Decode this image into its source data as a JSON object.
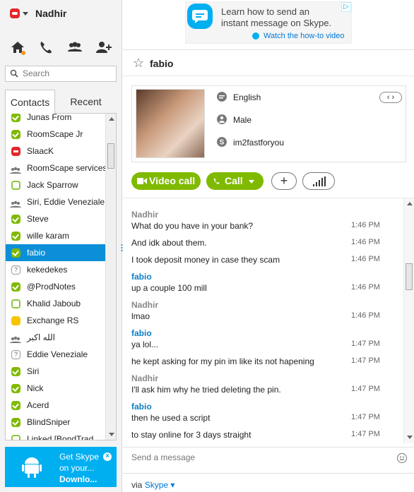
{
  "user": {
    "name": "Nadhir"
  },
  "nav": {
    "icons": [
      "home-icon",
      "phone-icon",
      "contacts-icon",
      "add-contact-icon"
    ]
  },
  "search": {
    "placeholder": "Search"
  },
  "tabs": {
    "contacts": "Contacts",
    "recent": "Recent"
  },
  "contacts": [
    {
      "name": "Junas From",
      "status": "online"
    },
    {
      "name": "RoomScape Jr",
      "status": "online"
    },
    {
      "name": "SlaacK",
      "status": "dnd"
    },
    {
      "name": "RoomScape services",
      "status": "group"
    },
    {
      "name": "Jack Sparrow",
      "status": "offline"
    },
    {
      "name": "Siri, Eddie Veneziale",
      "status": "group"
    },
    {
      "name": "Steve",
      "status": "online"
    },
    {
      "name": "wille karam",
      "status": "online"
    },
    {
      "name": "fabio",
      "status": "online",
      "selected": true
    },
    {
      "name": "kekedekes",
      "status": "unknown"
    },
    {
      "name": "@ProdNotes",
      "status": "online"
    },
    {
      "name": "Khalid Jaboub",
      "status": "offline"
    },
    {
      "name": "Exchange RS",
      "status": "away"
    },
    {
      "name": "الله اكبر",
      "status": "group"
    },
    {
      "name": "Eddie Veneziale",
      "status": "unknown"
    },
    {
      "name": "Siri",
      "status": "online"
    },
    {
      "name": "Nick",
      "status": "online"
    },
    {
      "name": "Acerd",
      "status": "online"
    },
    {
      "name": "BlindSniper",
      "status": "online"
    },
    {
      "name": "Linked [BondTrad...",
      "status": "offline"
    }
  ],
  "promo": {
    "line1": "Get Skype",
    "line2": "on your...",
    "line3": "Downlo..."
  },
  "ad": {
    "line1": "Learn how to send an",
    "line2": "instant message on Skype.",
    "link": "Watch the how-to video"
  },
  "conversation": {
    "name": "fabio",
    "profile": {
      "language": "English",
      "gender": "Male",
      "skype_name": "im2fastforyou",
      "pager": "‹ ›"
    },
    "actions": {
      "video": "Video call",
      "call": "Call"
    }
  },
  "messages": [
    {
      "type": "text",
      "text": "Nadhir",
      "sender": true,
      "who": "me"
    },
    {
      "type": "text",
      "text": "What do you have in your bank?",
      "time": "1:46 PM"
    },
    {
      "type": "text",
      "text": "And idk about them.",
      "time": "1:46 PM"
    },
    {
      "type": "text",
      "text": "I took deposit money in case they scam",
      "time": "1:46 PM"
    },
    {
      "type": "text",
      "text": "fabio",
      "sender": true,
      "who": "them"
    },
    {
      "type": "text",
      "text": "up a couple 100 mill",
      "time": "1:46 PM"
    },
    {
      "type": "text",
      "text": "Nadhir",
      "sender": true,
      "who": "me"
    },
    {
      "type": "text",
      "text": "lmao",
      "time": "1:46 PM"
    },
    {
      "type": "text",
      "text": "fabio",
      "sender": true,
      "who": "them"
    },
    {
      "type": "text",
      "text": "ya lol...",
      "time": "1:47 PM"
    },
    {
      "type": "text",
      "text": "he kept asking for my pin im like its not hapening",
      "time": "1:47 PM"
    },
    {
      "type": "text",
      "text": "Nadhir",
      "sender": true,
      "who": "me"
    },
    {
      "type": "text",
      "text": "I'll ask him why he tried deleting the pin.",
      "time": "1:47 PM"
    },
    {
      "type": "text",
      "text": "fabio",
      "sender": true,
      "who": "them"
    },
    {
      "type": "text",
      "text": "then he used a script",
      "time": "1:47 PM"
    },
    {
      "type": "text",
      "text": "to stay online for 3 days straight",
      "time": "1:47 PM"
    }
  ],
  "compose": {
    "placeholder": "Send a message"
  },
  "footer": {
    "via": "via",
    "service": "Skype ▾"
  },
  "colors": {
    "accent": "#00aff0",
    "green": "#7fba00",
    "selected": "#0d8fd8",
    "me": "#888888",
    "them": "#0d7fc4"
  }
}
